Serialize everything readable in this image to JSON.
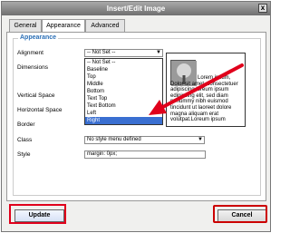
{
  "dialog": {
    "title": "Insert/Edit Image",
    "close_glyph": "x"
  },
  "tabs": [
    {
      "label": "General"
    },
    {
      "label": "Appearance"
    },
    {
      "label": "Advanced"
    }
  ],
  "fieldset": {
    "legend": "Appearance",
    "labels": {
      "alignment": "Alignment",
      "dimensions": "Dimensions",
      "vertical_space": "Vertical Space",
      "horizontal_space": "Horizontal Space",
      "border": "Border",
      "class": "Class",
      "style": "Style"
    },
    "alignment_select": {
      "value": "-- Not Set --",
      "arrow": "▼"
    },
    "alignment_options": [
      "-- Not Set --",
      "Baseline",
      "Top",
      "Middle",
      "Bottom",
      "Text Top",
      "Text Bottom",
      "Left",
      "Right"
    ],
    "selected_option_index": 8,
    "class_select": {
      "value": "No style menu defined",
      "arrow": "▼"
    },
    "style_input_value": "margin: 0px;"
  },
  "preview": {
    "text": "Lorem ipsum, Dolor sit amet, consectetuer adipiscing loreum ipsum edipiscing elit, sed diam nonummy nibh euismod tincidunt ut laoreet dolore magna aliquam erat volutpat.Loreum ipsum"
  },
  "buttons": {
    "update": "Update",
    "cancel": "Cancel"
  },
  "colors": {
    "accent_red": "#e0001b",
    "selected_blue": "#3a6fd1",
    "legend_blue": "#2b6fb6"
  }
}
